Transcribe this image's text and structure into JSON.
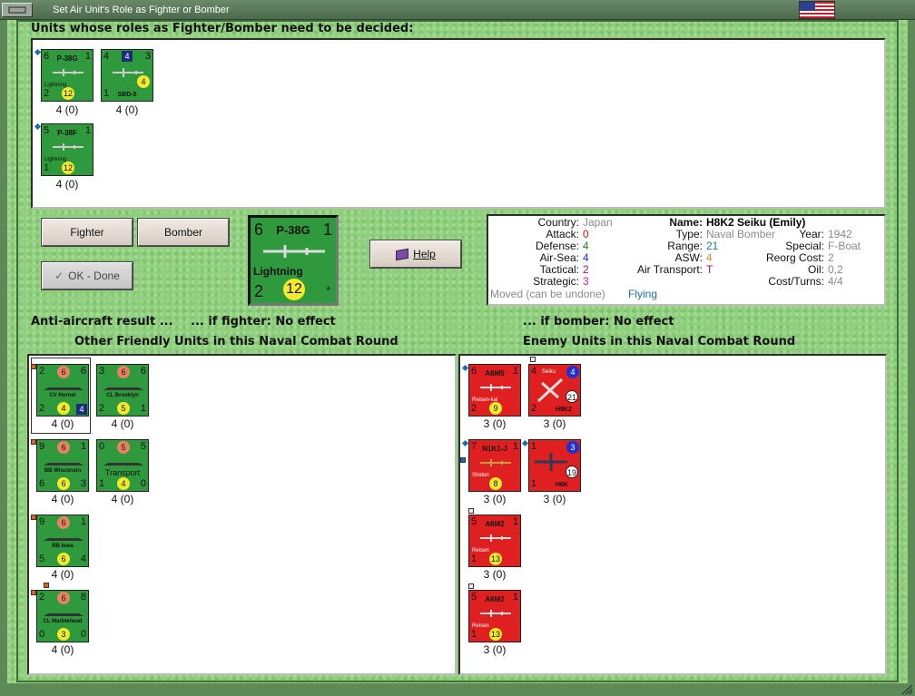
{
  "window": {
    "title": "Set Air Unit's Role as Fighter or Bomber"
  },
  "headings": {
    "decide": "Units whose roles as Fighter/Bomber need to be decided:",
    "aa_result": "Anti-aircraft result ...",
    "if_fighter": "... if fighter:  No effect",
    "if_bomber": "... if bomber:  No effect",
    "friendly": "Other Friendly Units in this Naval Combat Round",
    "enemy": "Enemy Units in this Naval Combat Round"
  },
  "buttons": {
    "fighter": "Fighter",
    "bomber": "Bomber",
    "ok_done": "OK - Done",
    "help": "Help"
  },
  "colors": {
    "green_counter": "#2e9a3d",
    "red_counter": "#e02020",
    "panel_bg": "#ffffff"
  },
  "pending_units": [
    {
      "name": "P-38G",
      "sub": "Lightning",
      "tl": "6",
      "tr": "1",
      "bl": "2",
      "circle": "12",
      "label": "4 (0)"
    },
    {
      "name": "SBD-5",
      "sub": "",
      "tl": "4",
      "tr": "3",
      "bl": "1",
      "sq": "4",
      "circle": "4",
      "label": "4 (0)"
    },
    {
      "name": "P-38F",
      "sub": "Lightning",
      "tl": "5",
      "tr": "1",
      "bl": "1",
      "circle": "12",
      "label": "4 (0)"
    }
  ],
  "selected": {
    "name": "P-38G",
    "sub": "Lightning",
    "tl": "6",
    "tr": "1",
    "bl": "2",
    "circle": "12",
    "star": "*"
  },
  "info": {
    "country_l": "Country:",
    "country": "Japan",
    "attack_l": "Attack:",
    "attack": "0",
    "defense_l": "Defense:",
    "defense": "4",
    "airsea_l": "Air-Sea:",
    "airsea": "4",
    "tactical_l": "Tactical:",
    "tactical": "2",
    "strategic_l": "Strategic:",
    "strategic": "3",
    "moved": "Moved (can be undone)",
    "flying": "Flying",
    "name_l": "Name:",
    "name": "H8K2 Seiku (Emily)",
    "type_l": "Type:",
    "type": "Naval Bomber",
    "year_l": "Year:",
    "year": "1942",
    "range_l": "Range:",
    "range": "21",
    "special_l": "Special:",
    "special": "F-Boat",
    "asw_l": "ASW:",
    "asw": "4",
    "reorg_l": "Reorg Cost:",
    "reorg": "2",
    "airtrans_l": "Air Transport:",
    "airtrans": "T",
    "oil_l": "Oil:",
    "oil": "0,2",
    "cost_l": "Cost/Turns:",
    "cost": "4/4"
  },
  "friendly_units": [
    {
      "name": "CV Hornet",
      "tl": "2",
      "tc": "6",
      "tr": "6",
      "bl": "2",
      "bc": "4",
      "br": "4",
      "label": "4 (0)"
    },
    {
      "name": "CL Brooklyn",
      "tl": "3",
      "tc": "6",
      "tr": "6",
      "bl": "2",
      "bc": "5",
      "br": "1",
      "label": "4 (0)"
    },
    {
      "name": "BB Wisconsin",
      "tl": "9",
      "tc": "6",
      "tr": "1",
      "bl": "6",
      "bc": "6",
      "br": "3",
      "label": "4 (0)"
    },
    {
      "name": "Transport",
      "tl": "0",
      "tc": "5",
      "tr": "5",
      "bl": "1",
      "bc": "4",
      "br": "0",
      "label": "4 (0)"
    },
    {
      "name": "BB Iowa",
      "tl": "9",
      "tc": "6",
      "tr": "1",
      "bl": "5",
      "bc": "6",
      "br": "4",
      "label": "4 (0)"
    },
    {
      "name": "CL Marblehead",
      "tl": "2",
      "tc": "6",
      "tr": "8",
      "bl": "0",
      "bc": "3",
      "br": "0",
      "label": "4 (0)"
    }
  ],
  "enemy_units": [
    {
      "name": "A6M5",
      "sub": "Reisen-kai",
      "tl": "6",
      "tr": "1",
      "bl": "2",
      "circle": "9",
      "label": "3 (0)"
    },
    {
      "name": "H8K2",
      "sub": "Seiku",
      "tl": "4",
      "bl": "2",
      "circ_top": "4",
      "circle": "21",
      "label": "3 (0)"
    },
    {
      "name": "N1K1-J",
      "sub": "Shiden",
      "tl": "7",
      "tr": "1",
      "bl": "",
      "circle": "8",
      "label": "3 (0)"
    },
    {
      "name": "H6K",
      "sub": "",
      "tl": "1",
      "bl": "1",
      "circ_top": "3",
      "circle": "19",
      "label": "3 (0)"
    },
    {
      "name": "A6M2",
      "sub": "Reisen",
      "tl": "5",
      "tr": "1",
      "bl": "1",
      "circle": "13",
      "label": "3 (0)"
    },
    {
      "name": "A6M2",
      "sub": "Reisen",
      "tl": "5",
      "tr": "1",
      "bl": "1",
      "circle": "13",
      "label": "3 (0)"
    }
  ]
}
